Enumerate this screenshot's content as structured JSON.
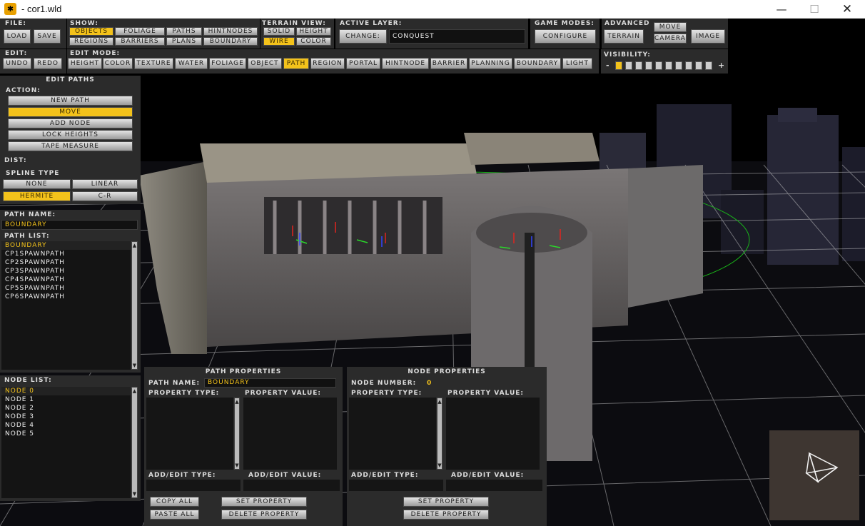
{
  "window": {
    "title": "- cor1.wld",
    "app_icon": "editor-icon",
    "minimize": "—",
    "maximize": "☐",
    "close": "✕"
  },
  "file": {
    "label": "File:",
    "load": "Load",
    "save": "Save"
  },
  "edit": {
    "label": "Edit:",
    "undo": "Undo",
    "redo": "Redo"
  },
  "show": {
    "label": "Show:",
    "objects": "Objects",
    "foliage": "Foliage",
    "paths": "Paths",
    "hintnodes": "HintNodes",
    "regions": "Regions",
    "barriers": "Barriers",
    "plans": "Plans",
    "boundary": "Boundary"
  },
  "terrain_view": {
    "label": "Terrain View:",
    "solid": "Solid",
    "height": "Height",
    "wire": "Wire",
    "color": "Color"
  },
  "active_layer": {
    "label": "Active Layer:",
    "change": "Change:",
    "value": "Conquest"
  },
  "game_modes": {
    "label": "Game Modes:",
    "configure": "Configure"
  },
  "advanced": {
    "label": "Advanced",
    "terrain": "Terrain",
    "move": "Move",
    "camera": "Camera",
    "image": "Image"
  },
  "edit_mode": {
    "label": "Edit Mode:",
    "modes": [
      "Height",
      "Color",
      "Texture",
      "Water",
      "Foliage",
      "Object",
      "Path",
      "Region",
      "Portal",
      "HintNode",
      "Barrier",
      "Planning",
      "Boundary",
      "Light"
    ],
    "active": "Path"
  },
  "visibility": {
    "label": "Visibility:",
    "minus": "-",
    "plus": "+",
    "level": 1,
    "steps": 10
  },
  "edit_paths": {
    "title": "Edit Paths",
    "action_label": "Action:",
    "actions": [
      "New Path",
      "Move",
      "Add Node",
      "Lock Heights",
      "Tape Measure"
    ],
    "active_action": "Move",
    "dist_label": "Dist:",
    "spline_label": "Spline Type",
    "splines": [
      "None",
      "Linear",
      "Hermite",
      "C-R"
    ],
    "active_spline": "Hermite",
    "path_name_label": "Path Name:",
    "path_name": "Boundary",
    "path_list_label": "Path List:",
    "paths": [
      "Boundary",
      "CP1SpawnPath",
      "CP2SpawnPath",
      "CP3SpawnPath",
      "CP4SpawnPath",
      "CP5SpawnPath",
      "CP6SpawnPath"
    ],
    "selected_path": "Boundary",
    "node_list_label": "Node List:",
    "nodes": [
      "Node 0",
      "Node 1",
      "Node 2",
      "Node 3",
      "Node 4",
      "Node 5"
    ],
    "selected_node": "Node 0"
  },
  "path_properties": {
    "title": "Path Properties",
    "name_label": "Path Name:",
    "name": "Boundary",
    "type_label": "Property Type:",
    "value_label": "Property Value:",
    "add_type_label": "Add/Edit Type:",
    "add_value_label": "Add/Edit Value:",
    "copy_all": "Copy All",
    "paste_all": "Paste All",
    "set_property": "Set Property",
    "delete_property": "Delete Property"
  },
  "node_properties": {
    "title": "Node Properties",
    "number_label": "Node Number:",
    "number": "0",
    "type_label": "Property Type:",
    "value_label": "Property Value:",
    "add_type_label": "Add/Edit Type:",
    "add_value_label": "Add/Edit Value:",
    "set_property": "Set Property",
    "delete_property": "Delete Property"
  },
  "icons": {
    "orientation_gizmo": "camera-orientation-icon"
  },
  "colors": {
    "accent": "#f3c21b",
    "panel": "#2b2b2b",
    "grid": "#d9d9d9"
  }
}
